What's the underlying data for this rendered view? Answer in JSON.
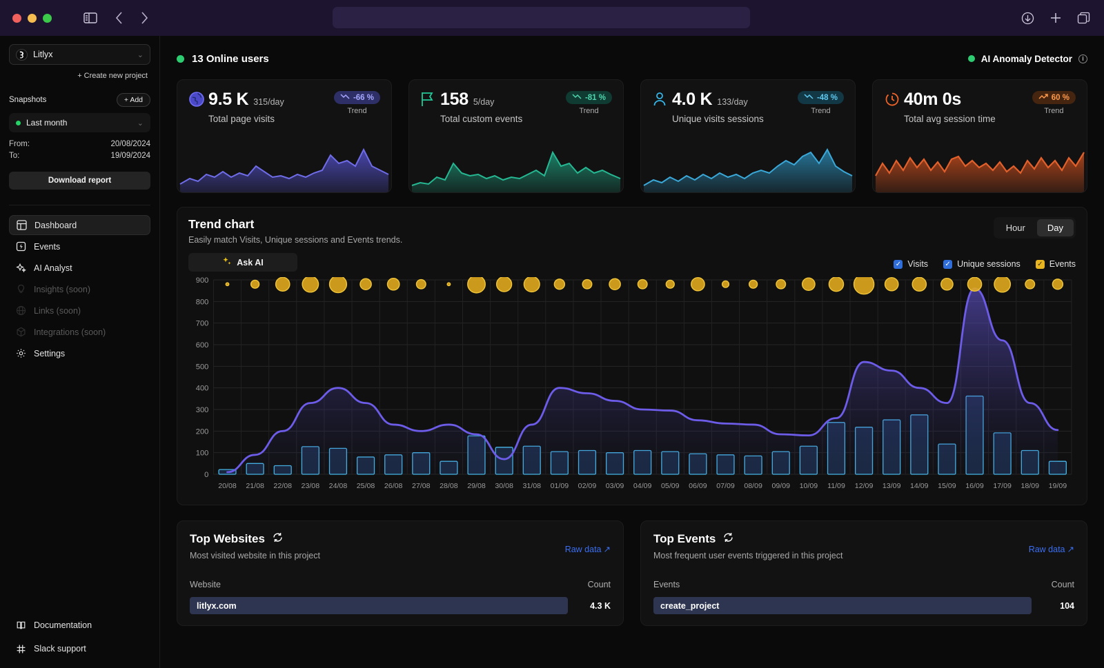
{
  "titlebar": {
    "sidebar_toggle_icon": "sidebar-panel-icon",
    "back_icon": "chevron-left-icon",
    "forward_icon": "chevron-right-icon",
    "url_value": "",
    "download_icon": "download-circle-icon",
    "new_tab_icon": "plus-icon",
    "tabs_icon": "copy-tabs-icon"
  },
  "sidebar": {
    "project": {
      "name": "Litlyx",
      "logo_icon": "litlyx-logo-icon",
      "chevron_icon": "chevron-down-icon"
    },
    "create_project": "+ Create new project",
    "snapshots_label": "Snapshots",
    "add_label": "+ Add",
    "range": {
      "value": "Last month",
      "status_icon": "green-status-dot",
      "chevron_icon": "chevron-down-icon"
    },
    "from_label": "From:",
    "from_value": "20/08/2024",
    "to_label": "To:",
    "to_value": "19/09/2024",
    "download_report": "Download report",
    "nav": [
      {
        "label": "Dashboard",
        "icon": "dashboard-icon",
        "active": true,
        "soon": false
      },
      {
        "label": "Events",
        "icon": "events-bolt-icon",
        "active": false,
        "soon": false
      },
      {
        "label": "AI Analyst",
        "icon": "ai-sparkles-icon",
        "active": false,
        "soon": false
      },
      {
        "label": "Insights (soon)",
        "icon": "lightbulb-icon",
        "active": false,
        "soon": true
      },
      {
        "label": "Links (soon)",
        "icon": "globe-links-icon",
        "active": false,
        "soon": true
      },
      {
        "label": "Integrations (soon)",
        "icon": "cube-icon",
        "active": false,
        "soon": true
      },
      {
        "label": "Settings",
        "icon": "gear-icon",
        "active": false,
        "soon": false
      }
    ],
    "bottom_nav": [
      {
        "label": "Documentation",
        "icon": "book-icon"
      },
      {
        "label": "Slack support",
        "icon": "slack-icon"
      }
    ]
  },
  "header": {
    "online_users": "13 Online users",
    "anomaly_detector": "AI Anomaly Detector",
    "info_icon": "info-icon"
  },
  "cards": [
    {
      "icon": "globe-icon",
      "icon_color": "#5b5be8",
      "value": "9.5 K",
      "per_day": "315/day",
      "label": "Total page visits",
      "trend": "-66 %",
      "trend_dir": "down",
      "trend_label": "Trend",
      "pill_bg": "#2e2f66",
      "pill_fg": "#a6a8ff",
      "accent": "#5b58e0"
    },
    {
      "icon": "flag-icon",
      "icon_color": "#20c997",
      "value": "158",
      "per_day": "5/day",
      "label": "Total custom events",
      "trend": "-81 %",
      "trend_dir": "down",
      "trend_label": "Trend",
      "pill_bg": "#0f3b33",
      "pill_fg": "#4fd6ae",
      "accent": "#1fae8a"
    },
    {
      "icon": "user-icon",
      "icon_color": "#35b6e8",
      "value": "4.0 K",
      "per_day": "133/day",
      "label": "Unique visits sessions",
      "trend": "-48 %",
      "trend_dir": "down",
      "trend_label": "Trend",
      "pill_bg": "#123745",
      "pill_fg": "#5fc9ef",
      "accent": "#2f9fd0"
    },
    {
      "icon": "timer-icon",
      "icon_color": "#f0642a",
      "value": "40m 0s",
      "per_day": "",
      "label": "Total avg session time",
      "trend": "60 %",
      "trend_dir": "up",
      "trend_label": "Trend",
      "pill_bg": "#45250f",
      "pill_fg": "#ff9a4d",
      "accent": "#d9531e"
    }
  ],
  "trend_panel": {
    "title": "Trend chart",
    "subtitle": "Easily match Visits, Unique sessions and Events trends.",
    "ask_ai": "Ask AI",
    "ask_ai_icon": "sparkles-icon",
    "granularity": [
      {
        "label": "Hour",
        "selected": false
      },
      {
        "label": "Day",
        "selected": true
      }
    ],
    "legend": [
      {
        "label": "Visits",
        "color": "#2f6ddb",
        "checked": true
      },
      {
        "label": "Unique sessions",
        "color": "#2f6ddb",
        "checked": true
      },
      {
        "label": "Events",
        "color": "#e8b420",
        "checked": true
      }
    ]
  },
  "chart_data": {
    "type": "line",
    "title": "Trend chart",
    "xlabel": "",
    "ylabel": "",
    "ylim": [
      0,
      900
    ],
    "yticks": [
      0,
      100,
      200,
      300,
      400,
      500,
      600,
      700,
      800,
      900
    ],
    "grid": true,
    "legend_position": "top-right",
    "categories": [
      "20/08",
      "21/08",
      "22/08",
      "23/08",
      "24/08",
      "25/08",
      "26/08",
      "27/08",
      "28/08",
      "29/08",
      "30/08",
      "31/08",
      "01/09",
      "02/09",
      "03/09",
      "04/09",
      "05/09",
      "06/09",
      "07/09",
      "08/09",
      "09/09",
      "10/09",
      "11/09",
      "12/09",
      "13/09",
      "14/09",
      "15/09",
      "16/09",
      "17/09",
      "18/09",
      "19/09"
    ],
    "series": [
      {
        "name": "Visits",
        "type": "area-line",
        "color": "#6c5ce7",
        "values": [
          10,
          90,
          200,
          330,
          400,
          330,
          230,
          200,
          230,
          185,
          70,
          230,
          400,
          375,
          340,
          300,
          295,
          250,
          235,
          230,
          185,
          180,
          260,
          520,
          480,
          400,
          330,
          860,
          620,
          330,
          205
        ]
      },
      {
        "name": "Unique sessions",
        "type": "bar",
        "color": "#47b6e8",
        "values": [
          22,
          50,
          40,
          128,
          120,
          80,
          90,
          100,
          60,
          178,
          125,
          130,
          105,
          110,
          100,
          110,
          105,
          95,
          90,
          85,
          105,
          130,
          240,
          218,
          252,
          275,
          140,
          362,
          192,
          110,
          60
        ]
      },
      {
        "name": "Events",
        "type": "bubble",
        "color": "#e0a81e",
        "baseline_y": 880,
        "values": [
          0,
          2,
          9,
          13,
          15,
          5,
          6,
          3,
          0,
          16,
          11,
          12,
          4,
          3,
          5,
          3,
          2,
          8,
          1,
          2,
          3,
          7,
          10,
          22,
          8,
          9,
          6,
          9,
          13,
          3,
          4
        ]
      }
    ]
  },
  "top_websites": {
    "title": "Top Websites",
    "refresh_icon": "refresh-icon",
    "subtitle": "Most visited website in this project",
    "raw_data": "Raw data",
    "raw_data_icon": "arrow-up-right-icon",
    "col_name": "Website",
    "col_count": "Count",
    "rows": [
      {
        "name": "litlyx.com",
        "count": "4.3 K",
        "pct": 100
      }
    ]
  },
  "top_events": {
    "title": "Top Events",
    "refresh_icon": "refresh-icon",
    "subtitle": "Most frequent user events triggered in this project",
    "raw_data": "Raw data",
    "raw_data_icon": "arrow-up-right-icon",
    "col_name": "Events",
    "col_count": "Count",
    "rows": [
      {
        "name": "create_project",
        "count": "104",
        "pct": 100
      }
    ]
  }
}
